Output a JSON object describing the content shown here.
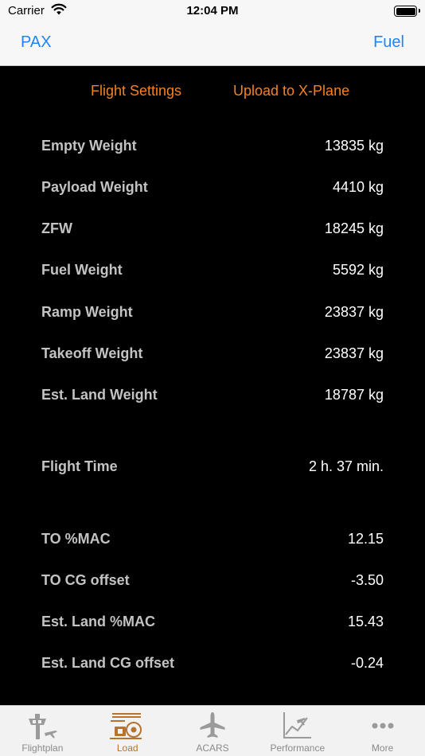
{
  "status": {
    "carrier": "Carrier",
    "time": "12:04 PM"
  },
  "nav": {
    "left": "PAX",
    "right": "Fuel"
  },
  "actions": {
    "settings": "Flight Settings",
    "upload": "Upload to X-Plane"
  },
  "weights": [
    {
      "label": "Empty Weight",
      "value": "13835 kg"
    },
    {
      "label": "Payload Weight",
      "value": "4410 kg"
    },
    {
      "label": "ZFW",
      "value": "18245 kg"
    },
    {
      "label": "Fuel Weight",
      "value": "5592 kg"
    },
    {
      "label": "Ramp Weight",
      "value": "23837 kg"
    },
    {
      "label": "Takeoff Weight",
      "value": "23837 kg"
    },
    {
      "label": "Est. Land Weight",
      "value": "18787 kg"
    }
  ],
  "time": {
    "label": "Flight Time",
    "value": "2 h. 37 min."
  },
  "balance": [
    {
      "label": "TO %MAC",
      "value": "12.15"
    },
    {
      "label": "TO CG offset",
      "value": "-3.50"
    },
    {
      "label": "Est. Land %MAC",
      "value": "15.43"
    },
    {
      "label": "Est. Land CG offset",
      "value": "-0.24"
    }
  ],
  "tabs": [
    {
      "label": "Flightplan",
      "icon": "control-tower-icon"
    },
    {
      "label": "Load",
      "icon": "cargo-icon",
      "active": true
    },
    {
      "label": "ACARS",
      "icon": "airplane-icon"
    },
    {
      "label": "Performance",
      "icon": "performance-chart-icon"
    },
    {
      "label": "More",
      "icon": "more-icon"
    }
  ],
  "colors": {
    "accent": "#f5821f",
    "link": "#1c84ff",
    "tab_active": "#b8722e",
    "tab_inactive": "#8a8a8a"
  }
}
